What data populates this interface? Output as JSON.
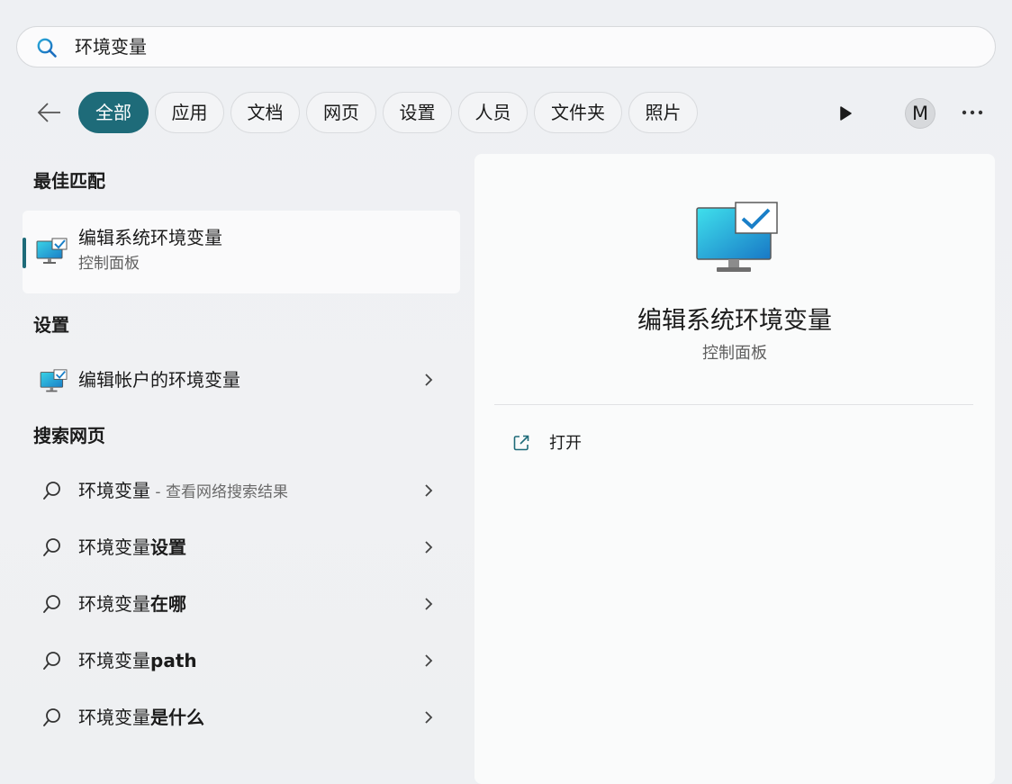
{
  "search": {
    "query": "环境变量"
  },
  "filters": [
    {
      "label": "全部",
      "active": true
    },
    {
      "label": "应用"
    },
    {
      "label": "文档"
    },
    {
      "label": "网页"
    },
    {
      "label": "设置"
    },
    {
      "label": "人员"
    },
    {
      "label": "文件夹"
    },
    {
      "label": "照片"
    }
  ],
  "account": {
    "initial": "M"
  },
  "sections": {
    "best_match": "最佳匹配",
    "settings": "设置",
    "web": "搜索网页"
  },
  "best_match": {
    "title": "编辑系统环境变量",
    "subtitle": "控制面板"
  },
  "settings_items": [
    {
      "label": "编辑帐户的环境变量"
    }
  ],
  "web_items": [
    {
      "prefix": "环境变量",
      "suffix": "",
      "hint": " - 查看网络搜索结果"
    },
    {
      "prefix": "环境变量",
      "suffix": "设置",
      "hint": ""
    },
    {
      "prefix": "环境变量",
      "suffix": "在哪",
      "hint": ""
    },
    {
      "prefix": "环境变量",
      "suffix": "path",
      "hint": ""
    },
    {
      "prefix": "环境变量",
      "suffix": "是什么",
      "hint": ""
    }
  ],
  "preview": {
    "title": "编辑系统环境变量",
    "subtitle": "控制面板",
    "actions": [
      {
        "label": "打开",
        "icon": "open-external-icon"
      }
    ]
  },
  "colors": {
    "accent": "#1e6b79"
  }
}
